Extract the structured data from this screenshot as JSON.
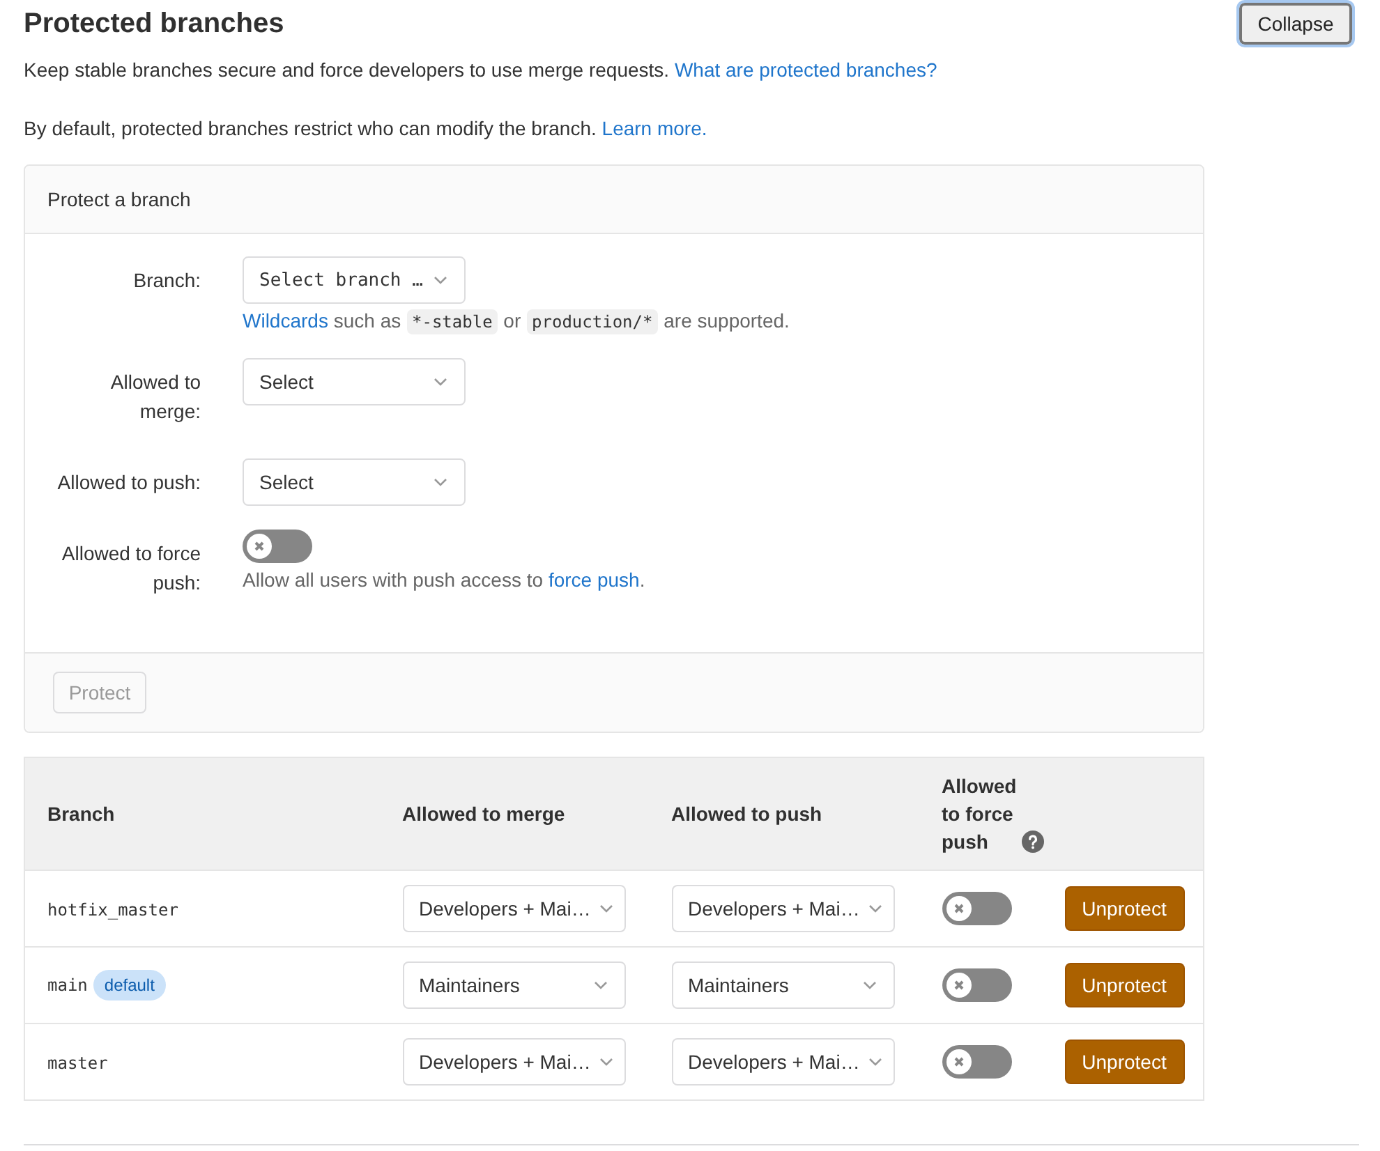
{
  "header": {
    "title": "Protected branches",
    "collapse_button": "Collapse"
  },
  "intro": {
    "text": "Keep stable branches secure and force developers to use merge requests.",
    "link": "What are protected branches?"
  },
  "note": {
    "text": "By default, protected branches restrict who can modify the branch.",
    "link": "Learn more."
  },
  "protect_form": {
    "title": "Protect a branch",
    "fields": [
      {
        "kind": "branch_select",
        "label": "Branch:",
        "value": "Select branch …",
        "hint": [
          {
            "kind": "link",
            "text": "Wildcards"
          },
          {
            "kind": "text",
            "text": " such as "
          },
          {
            "kind": "code",
            "text": "*-stable"
          },
          {
            "kind": "text",
            "text": " or "
          },
          {
            "kind": "code",
            "text": "production/*"
          },
          {
            "kind": "text",
            "text": " are supported."
          }
        ]
      },
      {
        "kind": "select",
        "label": "Allowed to merge:",
        "value": "Select"
      },
      {
        "kind": "select",
        "label": "Allowed to push:",
        "value": "Select"
      },
      {
        "kind": "toggle",
        "label": "Allowed to force push:",
        "on": false,
        "hint": [
          {
            "kind": "text",
            "text": "Allow all users with push access to "
          },
          {
            "kind": "link",
            "text": "force push"
          },
          {
            "kind": "text",
            "text": "."
          }
        ]
      }
    ],
    "protect_button": {
      "label": "Protect",
      "disabled": true
    }
  },
  "table": {
    "columns": [
      {
        "label": "Branch",
        "help": false
      },
      {
        "label": "Allowed to merge",
        "help": false
      },
      {
        "label": "Allowed to push",
        "help": false
      },
      {
        "label": "Allowed to force push",
        "help": true
      }
    ],
    "rows": [
      {
        "branch": "hotfix_master",
        "merge": "Developers + Mai…",
        "push": "Developers + Mai…",
        "force_push": false,
        "action": "Unprotect"
      },
      {
        "branch": "main",
        "badge": "default",
        "merge": "Maintainers",
        "push": "Maintainers",
        "force_push": false,
        "action": "Unprotect"
      },
      {
        "branch": "master",
        "merge": "Developers + Mai…",
        "push": "Developers + Mai…",
        "force_push": false,
        "action": "Unprotect"
      }
    ]
  }
}
